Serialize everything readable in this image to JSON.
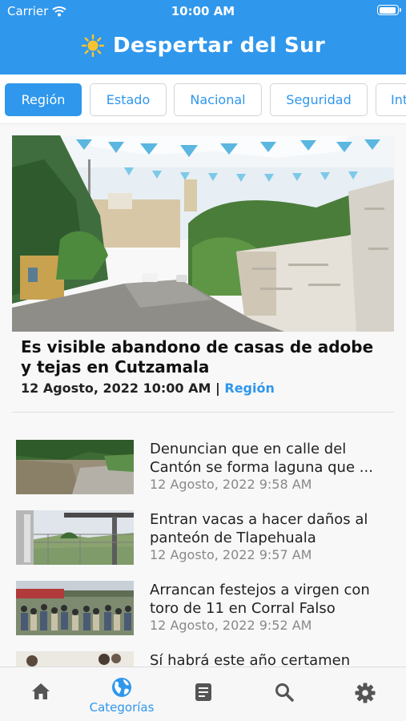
{
  "status_bar": {
    "carrier": "Carrier",
    "time": "10:00 AM"
  },
  "app": {
    "title": "Despertar del Sur",
    "accent_color": "#2f97ec",
    "logo_icon": "sun-icon"
  },
  "category_tabs": [
    {
      "label": "Región",
      "active": true
    },
    {
      "label": "Estado",
      "active": false
    },
    {
      "label": "Nacional",
      "active": false
    },
    {
      "label": "Seguridad",
      "active": false
    },
    {
      "label": "Int",
      "active": false
    }
  ],
  "featured": {
    "title": "Es visible abandono de casas de adobe y tejas en Cutzamala",
    "date": "12 Agosto, 2022 10:00 AM",
    "separator": " | ",
    "category": "Región"
  },
  "articles": [
    {
      "title": "Denuncian que en calle del Cantón se forma laguna que ...",
      "date": "12 Agosto, 2022 9:58 AM"
    },
    {
      "title": "Entran vacas a hacer daños al panteón de Tlapehuala",
      "date": "12 Agosto, 2022 9:57 AM"
    },
    {
      "title": "Arrancan festejos a virgen con toro de 11 en Corral Falso",
      "date": "12 Agosto, 2022 9:52 AM"
    },
    {
      "title": "Sí habrá este año certamen",
      "date": ""
    }
  ],
  "tab_bar": [
    {
      "icon": "home-icon",
      "label": "",
      "active": false
    },
    {
      "icon": "globe-icon",
      "label": "Categorías",
      "active": true
    },
    {
      "icon": "document-icon",
      "label": "",
      "active": false
    },
    {
      "icon": "search-icon",
      "label": "",
      "active": false
    },
    {
      "icon": "gear-icon",
      "label": "",
      "active": false
    }
  ]
}
